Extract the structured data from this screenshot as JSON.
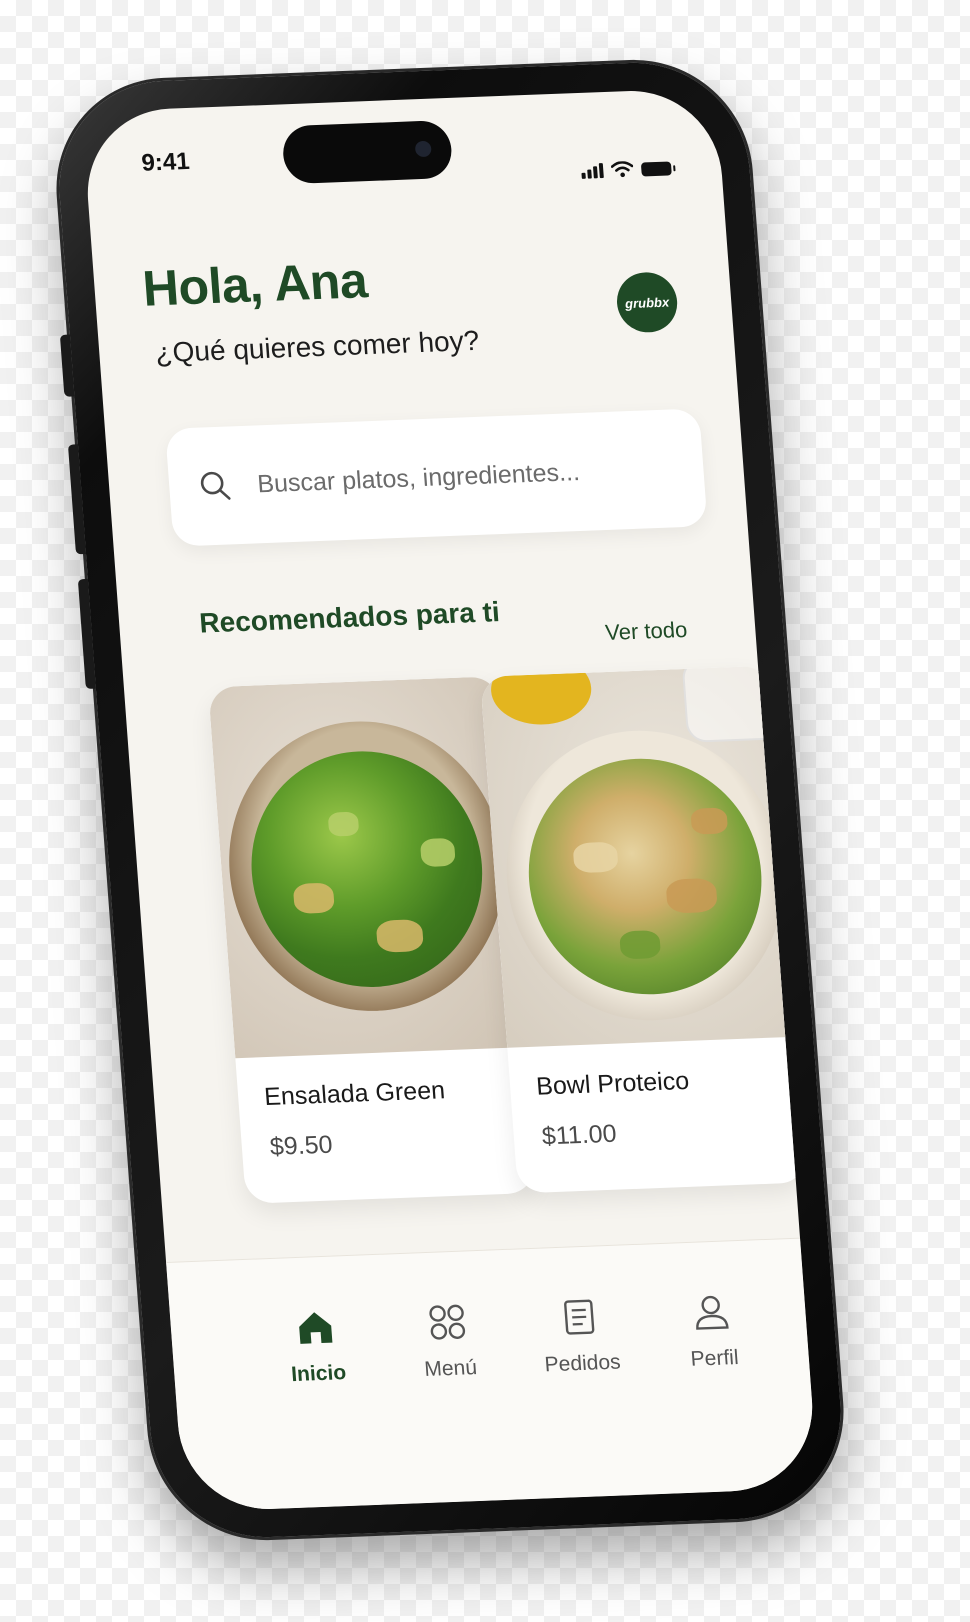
{
  "status_bar": {
    "time": "9:41"
  },
  "header": {
    "greeting": "Hola, Ana",
    "subtitle": "¿Qué quieres comer hoy?",
    "logo_text": "grubbx"
  },
  "search": {
    "placeholder": "Buscar platos, ingredientes..."
  },
  "recommended": {
    "title": "Recomendados para ti",
    "see_all": "Ver todo",
    "items": [
      {
        "name": "Ensalada Green",
        "price": "$9.50"
      },
      {
        "name": "Bowl Proteico",
        "price": "$11.00"
      }
    ]
  },
  "tabbar": {
    "tabs": [
      {
        "label": "Inicio",
        "icon": "home-icon",
        "active": true
      },
      {
        "label": "Menú",
        "icon": "grid-icon",
        "active": false
      },
      {
        "label": "Pedidos",
        "icon": "document-icon",
        "active": false
      },
      {
        "label": "Perfil",
        "icon": "user-icon",
        "active": false
      }
    ]
  },
  "colors": {
    "accent": "#1f4a26",
    "screen_bg": "#f6f4ef"
  }
}
